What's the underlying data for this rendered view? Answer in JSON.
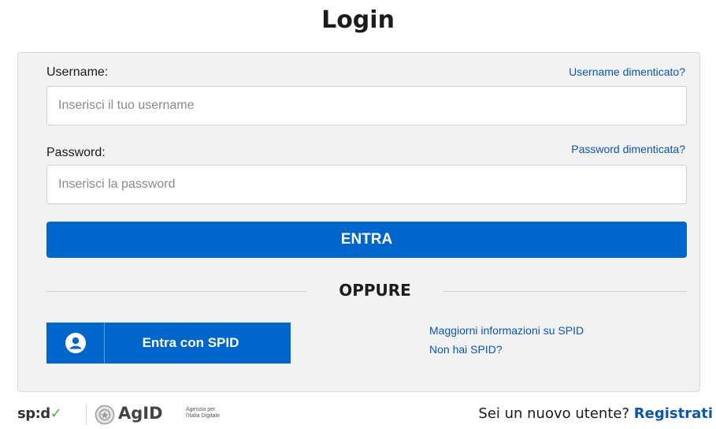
{
  "page": {
    "title": "Login"
  },
  "form": {
    "username_label": "Username:",
    "username_forgot": "Username dimenticato?",
    "username_placeholder": "Inserisci il tuo username",
    "password_label": "Password:",
    "password_forgot": "Password dimenticata?",
    "password_placeholder": "Inserisci la password",
    "submit_label": "ENTRA",
    "separator_text": "OPPURE"
  },
  "spid": {
    "button_label": "Entra con SPID",
    "icon": "user-icon",
    "info_link": "Maggiorni informazioni su SPID",
    "no_spid_link": "Non hai SPID?"
  },
  "footer": {
    "spid_logo": "sp:d",
    "agid_logo": "AgID",
    "agid_sub_1": "Agenzia per",
    "agid_sub_2": "l'Italia Digitale",
    "new_user_text": "Sei un nuovo utente?",
    "register_link": "Registrati"
  },
  "colors": {
    "primary": "#0066cc",
    "link": "#0b57a8",
    "panel_bg": "#f2f2f2"
  }
}
